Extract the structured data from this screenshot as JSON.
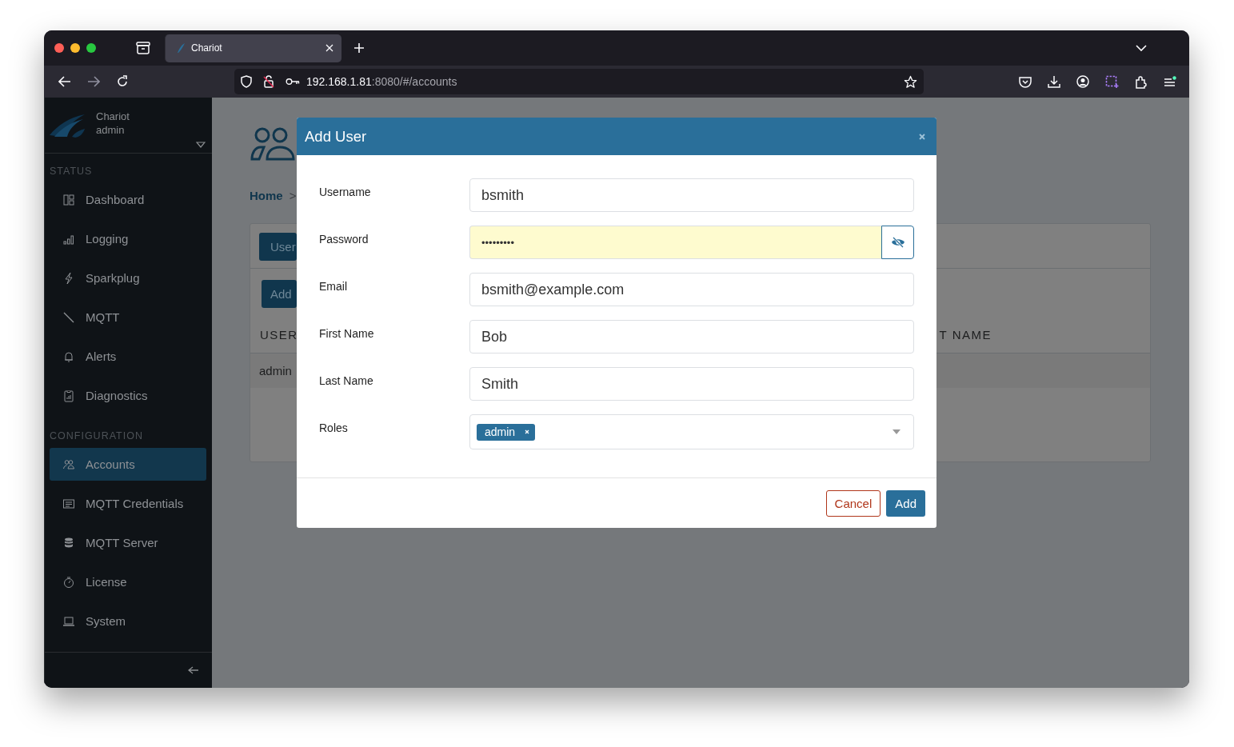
{
  "browser": {
    "tab_title": "Chariot",
    "url_host": "192.168.1.81",
    "url_rest": ":8080/#/accounts"
  },
  "sidebar": {
    "app_name": "Chariot",
    "user": "admin",
    "sections": [
      {
        "label": "STATUS",
        "items": [
          {
            "label": "Dashboard",
            "selected": false
          },
          {
            "label": "Logging",
            "selected": false
          },
          {
            "label": "Sparkplug",
            "selected": false
          },
          {
            "label": "MQTT",
            "selected": false
          },
          {
            "label": "Alerts",
            "selected": false
          },
          {
            "label": "Diagnostics",
            "selected": false
          }
        ]
      },
      {
        "label": "CONFIGURATION",
        "items": [
          {
            "label": "Accounts",
            "selected": true
          },
          {
            "label": "MQTT Credentials",
            "selected": false
          },
          {
            "label": "MQTT Server",
            "selected": false
          },
          {
            "label": "License",
            "selected": false
          },
          {
            "label": "System",
            "selected": false
          }
        ]
      }
    ]
  },
  "page": {
    "breadcrumb": "Home",
    "breadcrumb_separator": ">",
    "tab_button": "User",
    "add_button": "Add",
    "column_1": "USER",
    "column_2": "T NAME",
    "row_cell": "admin"
  },
  "dialog": {
    "title": "Add User",
    "fields": [
      {
        "label": "Username",
        "kind": "text",
        "value": "bsmith",
        "autofilled": false
      },
      {
        "label": "Password",
        "kind": "password",
        "value": "•••••••••",
        "autofilled": true
      },
      {
        "label": "Email",
        "kind": "text",
        "value": "bsmith@example.com",
        "autofilled": false
      },
      {
        "label": "First Name",
        "kind": "text",
        "value": "Bob",
        "autofilled": false
      },
      {
        "label": "Last Name",
        "kind": "text",
        "value": "Smith",
        "autofilled": false
      },
      {
        "label": "Roles",
        "kind": "tags",
        "tags": [
          "admin"
        ]
      }
    ],
    "cancel_button": "Cancel",
    "add_button": "Add"
  }
}
